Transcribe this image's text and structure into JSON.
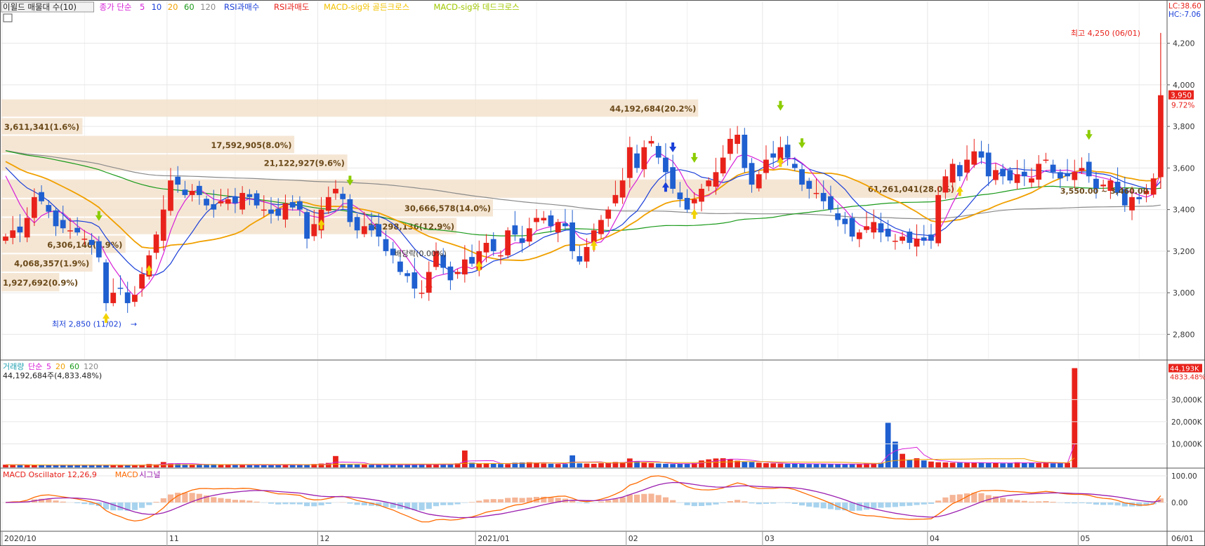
{
  "colors": {
    "up": "#e8221b",
    "down": "#1f5fd0",
    "ma5": "#d71fd7",
    "ma10": "#1a3fd8",
    "ma20": "#f0a000",
    "ma60": "#1a9a1a",
    "ma120": "#8a8a8a",
    "band": "#f3e2cd",
    "grid": "#e6e6e6",
    "axis_text": "#333333",
    "macd_line": "#ff6a00",
    "signal_line": "#9b1fb0",
    "osc_pos": "#f5b596",
    "osc_neg": "#a8d3ee"
  },
  "price_panel": {
    "legend": [
      {
        "text": "이윌드 매물대 수(10)",
        "color": "#222222",
        "boxed": true
      },
      {
        "text": "종가 단순",
        "color": "#d71fd7"
      },
      {
        "text": "5",
        "color": "#d71fd7"
      },
      {
        "text": "10",
        "color": "#1a3fd8"
      },
      {
        "text": "20",
        "color": "#f0a000"
      },
      {
        "text": "60",
        "color": "#1a9a1a"
      },
      {
        "text": "120",
        "color": "#8a8a8a"
      },
      {
        "text": "RSI과매수",
        "color": "#1a3fd8"
      },
      {
        "text": "RSI과매도",
        "color": "#e8221b"
      },
      {
        "text": "MACD-sig와 골든크로스",
        "color": "#f2c200"
      },
      {
        "text": "MACD-sig와 데드크로스",
        "color": "#a0c800"
      }
    ],
    "corner_lc": "LC:38.60",
    "corner_hc": "HC:-7.06",
    "last_price_box": "3,950",
    "last_change": "9.72%",
    "high_label": "최고 4,250 (06/01)",
    "low_label": "최저 2,850 (11/02)",
    "y_ticks": [
      {
        "v": 4200,
        "label": "4,200"
      },
      {
        "v": 4000,
        "label": "4,000"
      },
      {
        "v": 3800,
        "label": "3,800"
      },
      {
        "v": 3600,
        "label": "3,600"
      },
      {
        "v": 3400,
        "label": "3,400"
      },
      {
        "v": 3200,
        "label": "3,200"
      },
      {
        "v": 3000,
        "label": "3,000"
      },
      {
        "v": 2800,
        "label": "2,800"
      }
    ],
    "volume_profile": [
      {
        "label": "44,192,684(20.2%)",
        "lo": 3840,
        "hi": 3930,
        "pct": 20.2
      },
      {
        "label": "3,611,341(1.6%)",
        "lo": 3755,
        "hi": 3840,
        "pct": 1.6
      },
      {
        "label": "17,592,905(8.0%)",
        "lo": 3665,
        "hi": 3755,
        "pct": 8.0
      },
      {
        "label": "21,122,927(9.6%)",
        "lo": 3580,
        "hi": 3665,
        "pct": 9.6
      },
      {
        "label": "61,261,041(28.0%)",
        "lo": 3450,
        "hi": 3545,
        "pct": 28.0
      },
      {
        "label": "30,666,578(14.0%)",
        "lo": 3360,
        "hi": 3450,
        "pct": 14.0
      },
      {
        "label": "28,298,136(12.9%)",
        "lo": 3275,
        "hi": 3360,
        "pct": 12.9
      },
      {
        "label": "6,306,140(2.9%)",
        "lo": 3185,
        "hi": 3275,
        "pct": 2.9
      },
      {
        "label": "4,068,357(1.9%)",
        "lo": 3095,
        "hi": 3185,
        "pct": 1.9
      },
      {
        "label": "1,927,692(0.9%)",
        "lo": 3000,
        "hi": 3095,
        "pct": 0.9
      }
    ],
    "overlay_texts": [
      {
        "text": "배당락(0.00%)",
        "color": "#333333"
      },
      {
        "text": "3,550.00 ~ 3,460.00",
        "color": "#333333"
      }
    ]
  },
  "volume_panel": {
    "legend": [
      {
        "text": "거래량",
        "color": "#1f9fb0"
      },
      {
        "text": "단순",
        "color": "#d71fd7"
      },
      {
        "text": "5",
        "color": "#d71fd7"
      },
      {
        "text": "20",
        "color": "#f0a000"
      },
      {
        "text": "60",
        "color": "#1a9a1a"
      },
      {
        "text": "120",
        "color": "#8a8a8a"
      }
    ],
    "subtitle": "44,192,684주(4,833.48%)",
    "last_box": "44,193K",
    "last_pct": "4833.48%",
    "y_ticks": [
      {
        "v": 30000,
        "label": "30,000K"
      },
      {
        "v": 20000,
        "label": "20,000K"
      },
      {
        "v": 10000,
        "label": "10,000K"
      }
    ]
  },
  "macd_panel": {
    "legend": [
      {
        "text": "MACD Oscillator 12,26,9",
        "color": "#e8221b"
      },
      {
        "text": "MACD",
        "color": "#ff6a00"
      },
      {
        "text": "시그널",
        "color": "#9b1fb0"
      }
    ],
    "y_ticks": [
      {
        "v": 100,
        "label": "100.00"
      },
      {
        "v": 0,
        "label": "0.00"
      }
    ]
  },
  "x_labels": [
    {
      "i": 0,
      "label": "2020/10"
    },
    {
      "i": 23,
      "label": "11"
    },
    {
      "i": 44,
      "label": "12"
    },
    {
      "i": 66,
      "label": "2021/01"
    },
    {
      "i": 87,
      "label": "02"
    },
    {
      "i": 106,
      "label": "03"
    },
    {
      "i": 129,
      "label": "04"
    },
    {
      "i": 150,
      "label": "05"
    },
    {
      "i": 171,
      "label": "06"
    }
  ],
  "x_axis_right": "06/01",
  "chart_data": {
    "type": "candlestick",
    "title": "이윌드 매물대 수(10)",
    "ylim": [
      2700,
      4300
    ],
    "volume_unit": "K",
    "volume_max": 44193,
    "period_start": "2020/10",
    "period_end": "06/01",
    "high": {
      "value": 4250,
      "date": "06/01"
    },
    "low": {
      "value": 2850,
      "date": "11/02"
    },
    "closes": [
      3270,
      3300,
      3290,
      3360,
      3460,
      3440,
      3390,
      3320,
      3310,
      3300,
      3290,
      3260,
      3230,
      3170,
      2950,
      3000,
      3020,
      2950,
      2990,
      3090,
      3180,
      3280,
      3400,
      3540,
      3520,
      3470,
      3490,
      3470,
      3420,
      3400,
      3440,
      3450,
      3430,
      3480,
      3460,
      3420,
      3400,
      3380,
      3370,
      3430,
      3410,
      3400,
      3260,
      3330,
      3400,
      3460,
      3500,
      3450,
      3340,
      3300,
      3320,
      3300,
      3270,
      3200,
      3180,
      3100,
      3080,
      3020,
      3000,
      3100,
      3200,
      3120,
      3060,
      3100,
      3160,
      3140,
      3200,
      3240,
      3200,
      3180,
      3300,
      3280,
      3240,
      3310,
      3360,
      3360,
      3320,
      3340,
      3320,
      3200,
      3150,
      3220,
      3300,
      3350,
      3400,
      3470,
      3540,
      3700,
      3600,
      3700,
      3730,
      3650,
      3580,
      3500,
      3450,
      3400,
      3450,
      3500,
      3540,
      3580,
      3650,
      3740,
      3760,
      3600,
      3520,
      3570,
      3640,
      3650,
      3700,
      3650,
      3600,
      3520,
      3500,
      3480,
      3440,
      3400,
      3350,
      3330,
      3270,
      3290,
      3320,
      3340,
      3290,
      3270,
      3250,
      3270,
      3240,
      3260,
      3250,
      3250,
      3470,
      3560,
      3620,
      3560,
      3640,
      3680,
      3650,
      3560,
      3590,
      3560,
      3540,
      3570,
      3560,
      3550,
      3620,
      3640,
      3580,
      3550,
      3560,
      3580,
      3600,
      3560,
      3500,
      3520,
      3540,
      3480,
      3420,
      3460,
      3450,
      3490,
      3550,
      3950
    ],
    "volumes": [
      600,
      500,
      480,
      420,
      450,
      400,
      380,
      400,
      420,
      450,
      380,
      400,
      380,
      350,
      500,
      420,
      380,
      360,
      400,
      380,
      900,
      700,
      1800,
      1200,
      900,
      800,
      700,
      600,
      650,
      600,
      550,
      500,
      520,
      480,
      450,
      480,
      460,
      500,
      450,
      600,
      500,
      480,
      700,
      900,
      1100,
      1400,
      4500,
      900,
      700,
      650,
      600,
      550,
      500,
      520,
      600,
      700,
      650,
      600,
      600,
      650,
      700,
      800,
      900,
      1200,
      7000,
      1500,
      1100,
      1300,
      1000,
      900,
      850,
      1500,
      1600,
      1700,
      1500,
      1100,
      1000,
      900,
      900,
      4800,
      1200,
      1100,
      1000,
      1300,
      1600,
      1800,
      1700,
      3400,
      2200,
      1500,
      1300,
      1100,
      1000,
      900,
      1000,
      1100,
      1300,
      2500,
      3000,
      3400,
      3500,
      3100,
      2400,
      2000,
      1800,
      1500,
      1300,
      1200,
      1100,
      1000,
      1100,
      1000,
      900,
      900,
      950,
      900,
      850,
      800,
      800,
      850,
      1200,
      1300,
      1400,
      19500,
      11000,
      5500,
      2800,
      3500,
      2500,
      2000,
      1700,
      1600,
      1500,
      1500,
      1400,
      1600,
      1500,
      1300,
      1300,
      1200,
      1400,
      1700,
      1500,
      1400,
      1300,
      1300,
      1200,
      1300,
      1500,
      44193
    ]
  }
}
